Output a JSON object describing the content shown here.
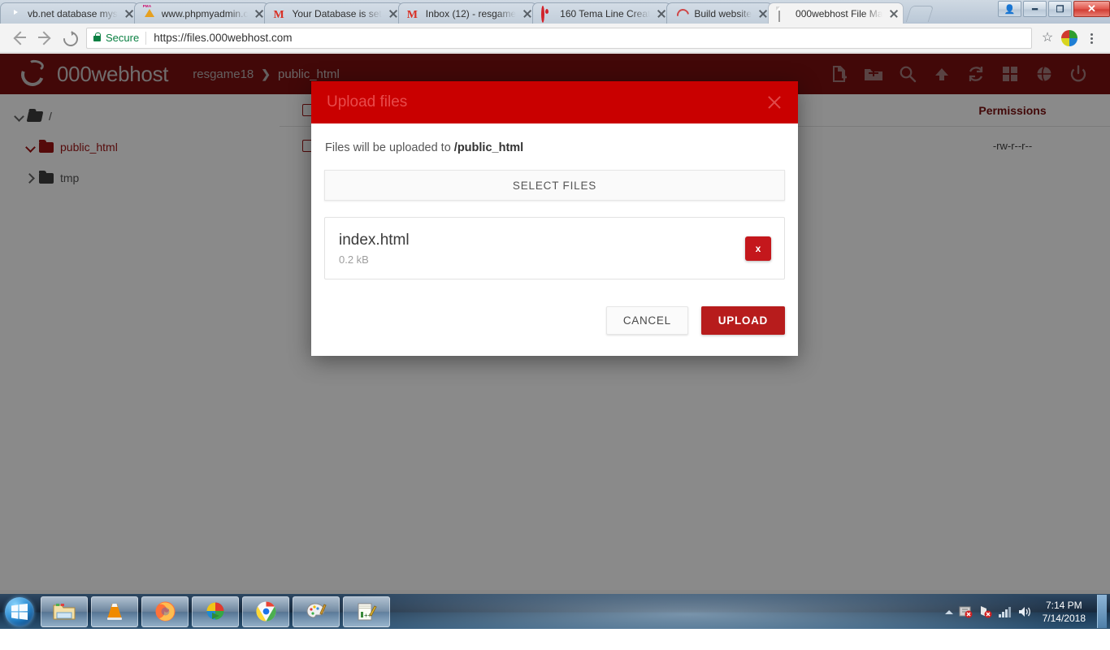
{
  "browser": {
    "tabs": [
      {
        "title": "vb.net database mys",
        "favicon": "youtube-icon",
        "active": false
      },
      {
        "title": "www.phpmyadmin.c",
        "favicon": "phpmyadmin-icon",
        "active": false
      },
      {
        "title": "Your Database is set",
        "favicon": "gmail-icon",
        "active": false
      },
      {
        "title": "Inbox (12) - resgame",
        "favicon": "gmail-icon",
        "active": false
      },
      {
        "title": "160 Tema Line Creat",
        "favicon": "location-icon",
        "active": false
      },
      {
        "title": "Build website",
        "favicon": "wix-icon",
        "active": false
      },
      {
        "title": "000webhost File Ma",
        "favicon": "document-icon",
        "active": true
      }
    ],
    "window_controls": {
      "user": "\u0000",
      "minimize": "–",
      "restore": "❐",
      "close": "✕"
    },
    "address": {
      "security_label": "Secure",
      "url": "https://files.000webhost.com"
    }
  },
  "page": {
    "header": {
      "logo_text": "000webhost",
      "breadcrumb": {
        "account": "resgame18",
        "separator": "❯",
        "current": "public_html"
      },
      "icons": [
        "new-file-icon",
        "new-folder-icon",
        "search-icon",
        "upload-icon",
        "refresh-icon",
        "apps-grid-icon",
        "globe-icon",
        "power-icon"
      ]
    },
    "sidebar": {
      "items": [
        {
          "label": "/",
          "expanded": true,
          "active": false,
          "depth": 1
        },
        {
          "label": "public_html",
          "expanded": true,
          "active": true,
          "depth": 2
        },
        {
          "label": "tmp",
          "expanded": false,
          "active": false,
          "depth": 2
        }
      ]
    },
    "filetable": {
      "columns": [
        "Permissions"
      ],
      "rows": [
        {
          "permissions": "-rw-r--r--"
        }
      ]
    }
  },
  "modal": {
    "title": "Upload files",
    "close_label": "✕",
    "destination_prefix": "Files will be uploaded to ",
    "destination_path": "/public_html",
    "select_files_label": "SELECT FILES",
    "files": [
      {
        "name": "index.html",
        "size": "0.2 kB",
        "remove_label": "x"
      }
    ],
    "cancel_label": "CANCEL",
    "upload_label": "UPLOAD"
  },
  "taskbar": {
    "start_label": "start-orb",
    "buttons": [
      "explorer-icon",
      "vlc-icon",
      "firefox-icon",
      "internet-download-manager-icon",
      "chrome-icon",
      "paint-icon",
      "notepadpp-icon"
    ],
    "tray": [
      "show-hidden-icons-arrow",
      "idm-tray-icon",
      "network-error-icon",
      "signal-bars-icon",
      "volume-icon"
    ],
    "clock_time": "7:14 PM",
    "clock_date": "7/14/2018"
  },
  "colors": {
    "brand_dark_red": "#7a0f0f",
    "modal_red": "#c90000",
    "upload_button_red": "#b71c1c",
    "accent_red": "#9e1313",
    "secure_green": "#0b8043"
  }
}
